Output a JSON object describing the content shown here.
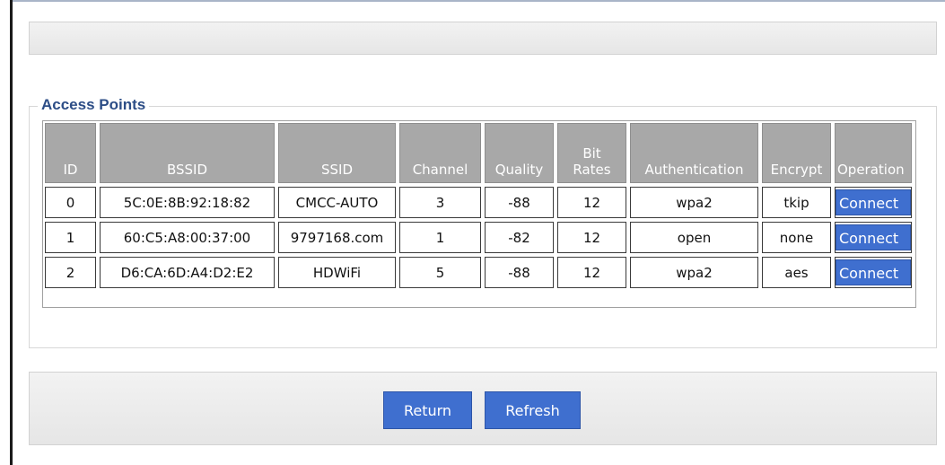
{
  "section_title": "Access Points",
  "table": {
    "headers": [
      "ID",
      "BSSID",
      "SSID",
      "Channel",
      "Quality",
      "Bit\nRates",
      "Authentication",
      "Encrypt",
      "Operation"
    ],
    "rows": [
      {
        "id": "0",
        "bssid": "5C:0E:8B:92:18:82",
        "ssid": "CMCC-AUTO",
        "channel": "3",
        "quality": "-88",
        "bit_rates": "12",
        "auth": "wpa2",
        "encrypt": "tkip",
        "operation": "Connect"
      },
      {
        "id": "1",
        "bssid": "60:C5:A8:00:37:00",
        "ssid": "9797168.com",
        "channel": "1",
        "quality": "-82",
        "bit_rates": "12",
        "auth": "open",
        "encrypt": "none",
        "operation": "Connect"
      },
      {
        "id": "2",
        "bssid": "D6:CA:6D:A4:D2:E2",
        "ssid": "HDWiFi",
        "channel": "5",
        "quality": "-88",
        "bit_rates": "12",
        "auth": "wpa2",
        "encrypt": "aes",
        "operation": "Connect"
      }
    ]
  },
  "buttons": {
    "return_label": "Return",
    "refresh_label": "Refresh"
  },
  "colors": {
    "accent": "#3f6fcf",
    "header_bg": "#a8a8a8",
    "legend_text": "#2c4d86"
  }
}
